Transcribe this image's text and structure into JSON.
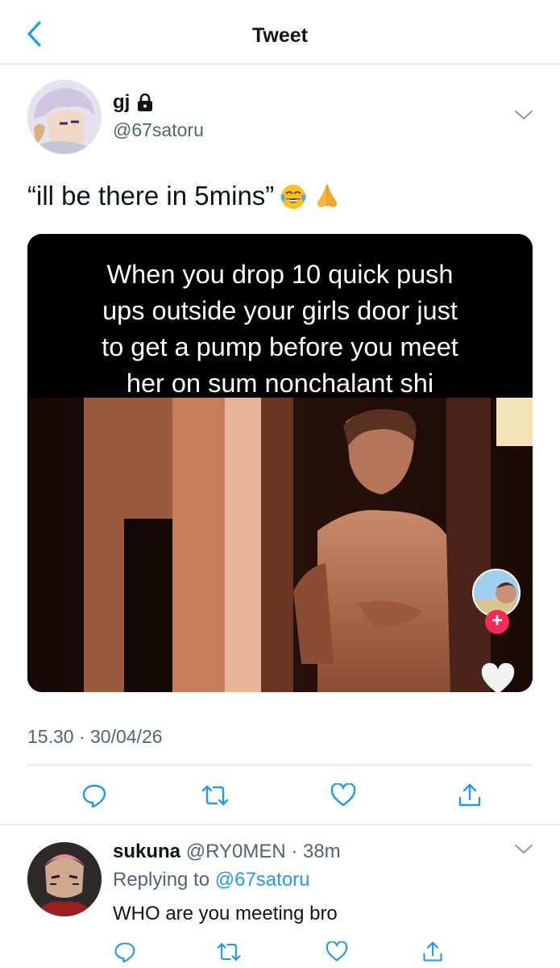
{
  "header": {
    "title": "Tweet",
    "back_icon": "chevron-left-icon"
  },
  "tweet": {
    "author_name": "gj",
    "author_handle": "@67satoru",
    "protected_icon": "lock-icon",
    "text": "“ill be there in 5mins”",
    "emojis": [
      "face-with-tears-of-joy",
      "folded-hands"
    ],
    "media": {
      "caption_lines": [
        "When you drop  10 quick push",
        "ups outside your girls door just",
        "to get a pump before you meet",
        "her  on sum nonchalant shi"
      ],
      "overlay_follow_badge": "+",
      "overlay_like_icon": "heart-icon"
    },
    "timestamp": "15.30 · 30/04/26",
    "actions": [
      "reply-icon",
      "retweet-icon",
      "like-icon",
      "share-icon"
    ]
  },
  "reply": {
    "name": "sukuna",
    "handle_time": "@RY0MEN · 38m",
    "replying_prefix": "Replying to ",
    "replying_to": "@67satoru",
    "text": "WHO are you meeting bro",
    "actions": [
      "reply-icon",
      "retweet-icon",
      "like-icon",
      "share-icon"
    ]
  },
  "colors": {
    "accent": "#1d9bf0",
    "secondary_text": "#536471",
    "divider": "#dcdcdc"
  }
}
